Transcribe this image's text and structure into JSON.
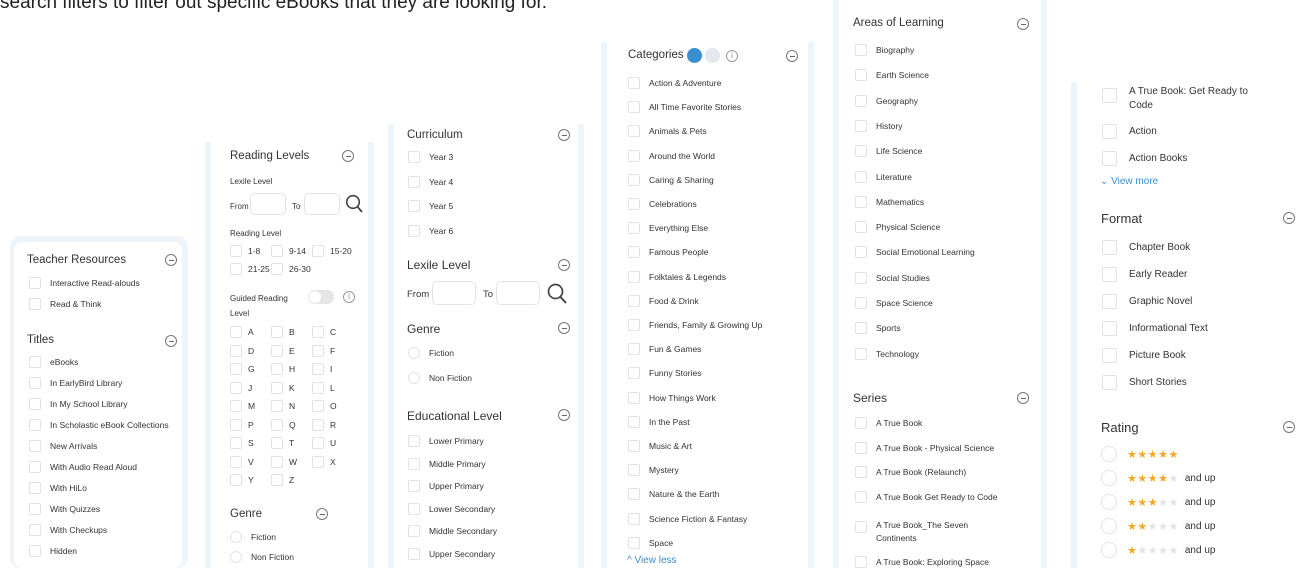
{
  "intro_text": "search filters to filter out specific eBooks that they are looking for.",
  "panel1": {
    "teacher_title": "Teacher Resources",
    "teacher_items": [
      "Interactive Read-alouds",
      "Read & Think"
    ],
    "titles_title": "Titles",
    "titles_items": [
      "eBooks",
      "In EarlyBird Library",
      "In My School Library",
      "In Scholastic eBook Collections",
      "New Arrivals",
      "With Audio Read Aloud",
      "With HiLo",
      "With Quizzes",
      "With Checkups",
      "Hidden"
    ]
  },
  "panel2": {
    "title": "Reading Levels",
    "lexile_label": "Lexile Level",
    "from_label": "From",
    "to_label": "To",
    "reading_level_label": "Reading Level",
    "reading_levels": [
      "1-8",
      "9-14",
      "15-20",
      "21-25",
      "26-30"
    ],
    "guided_label_1": "Guided Reading",
    "guided_label_2": "Level",
    "guided_levels": [
      "A",
      "B",
      "C",
      "D",
      "E",
      "F",
      "G",
      "H",
      "I",
      "J",
      "K",
      "L",
      "M",
      "N",
      "O",
      "P",
      "Q",
      "R",
      "S",
      "T",
      "U",
      "V",
      "W",
      "X",
      "Y",
      "Z"
    ],
    "genre_title": "Genre",
    "genre_items": [
      "Fiction",
      "Non Fiction"
    ]
  },
  "panel3": {
    "curriculum_title": "Curriculum",
    "curriculum_items": [
      "Year 3",
      "Year 4",
      "Year 5",
      "Year 6"
    ],
    "lexile_title": "Lexile Level",
    "from_label": "From",
    "to_label": "To",
    "genre_title": "Genre",
    "genre_items": [
      "Fiction",
      "Non Fiction"
    ],
    "edu_title": "Educational Level",
    "edu_items": [
      "Lower Primary",
      "Middle Primary",
      "Upper Primary",
      "Lower Secondary",
      "Middle Secondary",
      "Upper Secondary"
    ]
  },
  "panel4": {
    "title": "Categories",
    "items": [
      "Action & Adventure",
      "All Time Favorite Stories",
      "Animals & Pets",
      "Around the World",
      "Caring & Sharing",
      "Celebrations",
      "Everything Else",
      "Famous People",
      "Folktales & Legends",
      "Food & Drink",
      "Friends, Family & Growing Up",
      "Fun & Games",
      "Funny Stories",
      "How Things Work",
      "In the Past",
      "Music & Art",
      "Mystery",
      "Nature & the Earth",
      "Science Fiction & Fantasy",
      "Space"
    ],
    "view_less": "^ View less"
  },
  "panel5": {
    "areas_title": "Areas of Learning",
    "areas_items": [
      "Biography",
      "Earth Science",
      "Geography",
      "History",
      "Life Science",
      "Literature",
      "Mathematics",
      "Physical Science",
      "Social Emotional Learning",
      "Social Studies",
      "Space Science",
      "Sports",
      "Technology"
    ],
    "series_title": "Series",
    "series_items": [
      "A True Book",
      "A True Book - Physical Science",
      "A True Book (Relaunch)",
      "A True Book Get Ready to Code"
    ],
    "series_multi_1": "A True Book_The Seven",
    "series_multi_2": "Continents",
    "series_last": "A True Book: Exploring Space"
  },
  "panel6": {
    "series_tail_1": "A True Book: Get Ready to",
    "series_tail_2": "Code",
    "series_tail_items": [
      "Action",
      "Action Books"
    ],
    "view_more": "⌄ View more",
    "format_title": "Format",
    "format_items": [
      "Chapter Book",
      "Early Reader",
      "Graphic Novel",
      "Informational Text",
      "Picture Book",
      "Short Stories"
    ],
    "rating_title": "Rating",
    "rating_suffix": "and up",
    "ratings": [
      5,
      4,
      3,
      2,
      1
    ]
  },
  "colors": {
    "accent": "#3a8fd0",
    "star": "#f5a623",
    "panel_bar": "#eef5fa"
  }
}
